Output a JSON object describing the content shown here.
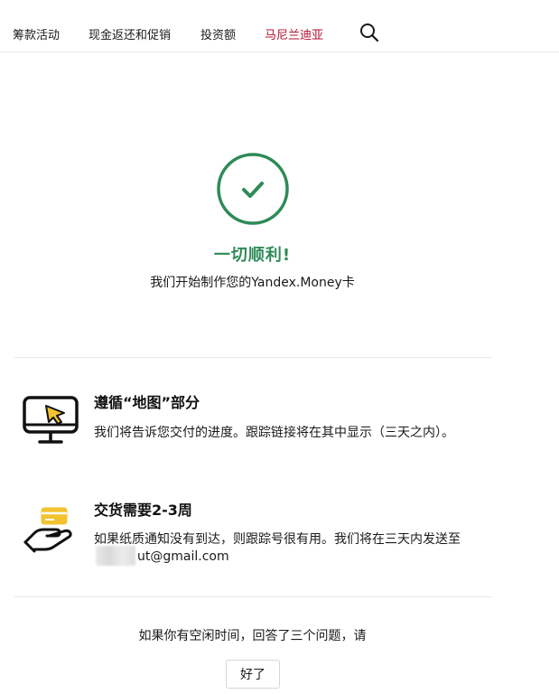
{
  "nav": {
    "items": [
      {
        "label": "筹款活动"
      },
      {
        "label": "现金返还和促销"
      },
      {
        "label": "投资额"
      },
      {
        "label": "马尼兰迪亚"
      }
    ],
    "active_color": "#b0102b",
    "search_icon": "search-icon"
  },
  "success": {
    "icon": "check-circle-icon",
    "color": "#2e8b57",
    "title": "一切顺利!",
    "subtitle": "我们开始制作您的Yandex.Money卡"
  },
  "info": [
    {
      "icon": "monitor-cursor-icon",
      "title": "遵循“地图”部分",
      "text": "我们将告诉您交付的进度。跟踪链接将在其中显示（三天之内）。"
    },
    {
      "icon": "hand-card-icon",
      "title": "交货需要2-3周",
      "text": "如果纸质通知没有到达，则跟踪号很有用。我们将在三天内发送至",
      "email": "ut@gmail.com"
    }
  ],
  "survey": {
    "text": "如果你有空闲时间，回答了三个问题，请",
    "button_label": "好了"
  },
  "colors": {
    "accent_green": "#2e8b57",
    "icon_yellow": "#f2c230"
  }
}
